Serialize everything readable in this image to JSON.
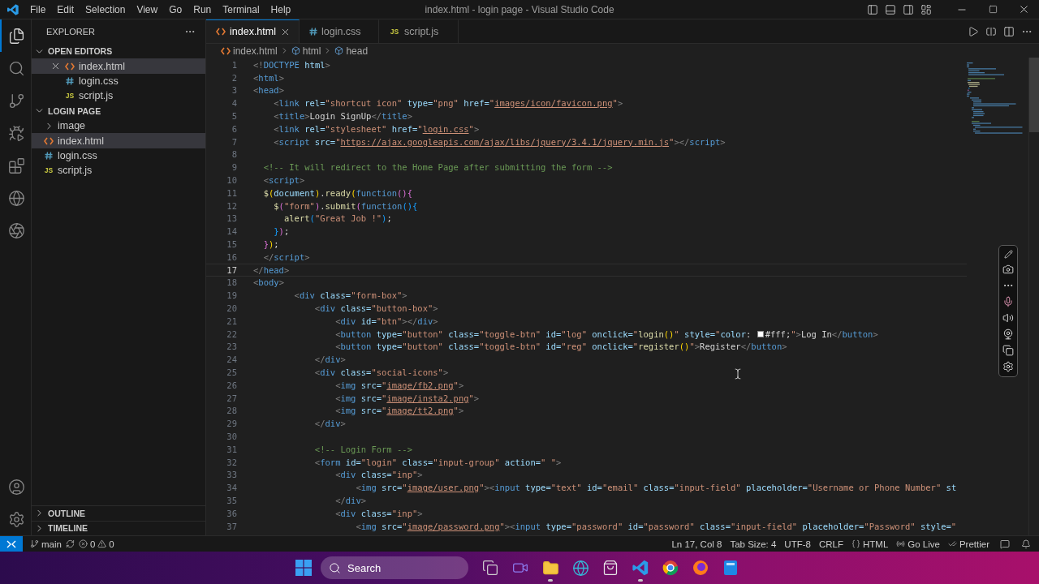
{
  "window": {
    "title": "index.html - login page - Visual Studio Code",
    "menu": [
      "File",
      "Edit",
      "Selection",
      "View",
      "Go",
      "Run",
      "Terminal",
      "Help"
    ]
  },
  "activity_bar": {
    "top": [
      {
        "kind": "files",
        "selected": true
      },
      {
        "kind": "search",
        "selected": false
      },
      {
        "kind": "source-control",
        "selected": false
      },
      {
        "kind": "run-debug",
        "selected": false
      },
      {
        "kind": "extensions",
        "selected": false
      },
      {
        "kind": "globe",
        "selected": false
      },
      {
        "kind": "aperture",
        "selected": false
      }
    ],
    "bottom": [
      {
        "kind": "account"
      },
      {
        "kind": "settings"
      }
    ]
  },
  "explorer": {
    "title": "EXPLORER",
    "sections": [
      {
        "title": "OPEN EDITORS",
        "expanded": true,
        "items": [
          {
            "name": "index.html",
            "kind": "html",
            "selected": true,
            "closable": true
          },
          {
            "name": "login.css",
            "kind": "css",
            "selected": false,
            "closable": false
          },
          {
            "name": "script.js",
            "kind": "js",
            "badge": "JS",
            "selected": false,
            "closable": false
          }
        ]
      },
      {
        "title": "LOGIN PAGE",
        "expanded": true,
        "items": [
          {
            "name": "image",
            "kind": "folder",
            "expanded": false,
            "selected": false
          },
          {
            "name": "index.html",
            "kind": "html",
            "selected": true
          },
          {
            "name": "login.css",
            "kind": "css",
            "selected": false
          },
          {
            "name": "script.js",
            "kind": "js",
            "badge": "JS",
            "selected": false
          }
        ]
      }
    ],
    "bottom_sections": [
      {
        "title": "OUTLINE",
        "expanded": false
      },
      {
        "title": "TIMELINE",
        "expanded": false
      }
    ]
  },
  "tabs": [
    {
      "name": "index.html",
      "kind": "html",
      "selected": true,
      "closable": true
    },
    {
      "name": "login.css",
      "kind": "css",
      "selected": false,
      "closable": false
    },
    {
      "name": "script.js",
      "kind": "js",
      "badge": "JS",
      "selected": false,
      "closable": false
    }
  ],
  "breadcrumb": [
    {
      "label": "index.html",
      "kind": "html"
    },
    {
      "label": "html",
      "kind": "symbol"
    },
    {
      "label": "head",
      "kind": "symbol"
    }
  ],
  "editor": {
    "lines": [
      {
        "number": "1",
        "current": false,
        "tokens": [
          {
            "kind": "p",
            "text": "<!"
          },
          {
            "kind": "tag",
            "text": "DOCTYPE"
          },
          {
            "kind": "attr",
            "text": " html"
          },
          {
            "kind": "p",
            "text": ">"
          }
        ]
      },
      {
        "number": "2",
        "current": false,
        "tokens": [
          {
            "kind": "p",
            "text": "<"
          },
          {
            "kind": "tag",
            "text": "html"
          },
          {
            "kind": "p",
            "text": ">"
          }
        ]
      },
      {
        "number": "3",
        "current": false,
        "tokens": [
          {
            "kind": "p",
            "text": "<"
          },
          {
            "kind": "tag",
            "text": "head"
          },
          {
            "kind": "p",
            "text": ">"
          }
        ]
      },
      {
        "number": "4",
        "current": false,
        "tokens": [
          {
            "kind": "p",
            "text": "    <"
          },
          {
            "kind": "tag",
            "text": "link"
          },
          {
            "kind": "attr",
            "text": " rel="
          },
          {
            "kind": "str",
            "text": "\"shortcut icon\""
          },
          {
            "kind": "attr",
            "text": " type="
          },
          {
            "kind": "str",
            "text": "\"png\""
          },
          {
            "kind": "attr",
            "text": " href="
          },
          {
            "kind": "str",
            "text": "\""
          },
          {
            "kind": "link",
            "text": "images/icon/favicon.png"
          },
          {
            "kind": "str",
            "text": "\""
          },
          {
            "kind": "p",
            "text": ">"
          }
        ]
      },
      {
        "number": "5",
        "current": false,
        "tokens": [
          {
            "kind": "p",
            "text": "    <"
          },
          {
            "kind": "tag",
            "text": "title"
          },
          {
            "kind": "p",
            "text": ">"
          },
          {
            "kind": "text",
            "text": "Login SignUp"
          },
          {
            "kind": "p",
            "text": "</"
          },
          {
            "kind": "tag",
            "text": "title"
          },
          {
            "kind": "p",
            "text": ">"
          }
        ]
      },
      {
        "number": "6",
        "current": false,
        "tokens": [
          {
            "kind": "p",
            "text": "    <"
          },
          {
            "kind": "tag",
            "text": "link"
          },
          {
            "kind": "attr",
            "text": " rel="
          },
          {
            "kind": "str",
            "text": "\"stylesheet\""
          },
          {
            "kind": "attr",
            "text": " href="
          },
          {
            "kind": "str",
            "text": "\""
          },
          {
            "kind": "link",
            "text": "login.css"
          },
          {
            "kind": "str",
            "text": "\""
          },
          {
            "kind": "p",
            "text": ">"
          }
        ]
      },
      {
        "number": "7",
        "current": false,
        "tokens": [
          {
            "kind": "p",
            "text": "    <"
          },
          {
            "kind": "tag",
            "text": "script"
          },
          {
            "kind": "attr",
            "text": " src="
          },
          {
            "kind": "str",
            "text": "\""
          },
          {
            "kind": "link",
            "text": "https://ajax.googleapis.com/ajax/libs/jquery/3.4.1/jquery.min.js"
          },
          {
            "kind": "str",
            "text": "\""
          },
          {
            "kind": "p",
            "text": "></"
          },
          {
            "kind": "tag",
            "text": "script"
          },
          {
            "kind": "p",
            "text": ">"
          }
        ]
      },
      {
        "number": "8",
        "current": false
      },
      {
        "number": "9",
        "current": false,
        "tokens": [
          {
            "kind": "cmt",
            "text": "  <!-- It will redirect to the Home Page after submitting the form -->"
          }
        ]
      },
      {
        "number": "10",
        "current": false,
        "tokens": [
          {
            "kind": "p",
            "text": "  <"
          },
          {
            "kind": "tag",
            "text": "script"
          },
          {
            "kind": "p",
            "text": ">"
          }
        ]
      },
      {
        "number": "11",
        "current": false,
        "tokens": [
          {
            "kind": "fn",
            "text": "  $"
          },
          {
            "kind": "b1",
            "text": "("
          },
          {
            "kind": "attr",
            "text": "document"
          },
          {
            "kind": "b1",
            "text": ")"
          },
          {
            "kind": "text",
            "text": "."
          },
          {
            "kind": "fn",
            "text": "ready"
          },
          {
            "kind": "b1",
            "text": "("
          },
          {
            "kind": "kw",
            "text": "function"
          },
          {
            "kind": "b2",
            "text": "(){"
          }
        ]
      },
      {
        "number": "12",
        "current": false,
        "tokens": [
          {
            "kind": "fn",
            "text": "    $"
          },
          {
            "kind": "b2",
            "text": "("
          },
          {
            "kind": "str",
            "text": "\"form\""
          },
          {
            "kind": "b2",
            "text": ")"
          },
          {
            "kind": "text",
            "text": "."
          },
          {
            "kind": "fn",
            "text": "submit"
          },
          {
            "kind": "b2",
            "text": "("
          },
          {
            "kind": "kw",
            "text": "function"
          },
          {
            "kind": "b3",
            "text": "(){"
          }
        ]
      },
      {
        "number": "13",
        "current": false,
        "tokens": [
          {
            "kind": "fn",
            "text": "      alert"
          },
          {
            "kind": "b3",
            "text": "("
          },
          {
            "kind": "str",
            "text": "\"Great Job !\""
          },
          {
            "kind": "b3",
            "text": ")"
          },
          {
            "kind": "text",
            "text": ";"
          }
        ]
      },
      {
        "number": "14",
        "current": false,
        "tokens": [
          {
            "kind": "b3",
            "text": "    }"
          },
          {
            "kind": "b2",
            "text": ")"
          },
          {
            "kind": "text",
            "text": ";"
          }
        ]
      },
      {
        "number": "15",
        "current": false,
        "tokens": [
          {
            "kind": "b2",
            "text": "  }"
          },
          {
            "kind": "b1",
            "text": ")"
          },
          {
            "kind": "text",
            "text": ";"
          }
        ]
      },
      {
        "number": "16",
        "current": false,
        "tokens": [
          {
            "kind": "p",
            "text": "  </"
          },
          {
            "kind": "tag",
            "text": "script"
          },
          {
            "kind": "p",
            "text": ">"
          }
        ]
      },
      {
        "number": "17",
        "current": true,
        "tokens": [
          {
            "kind": "p",
            "text": "</"
          },
          {
            "kind": "tag",
            "text": "head"
          },
          {
            "kind": "p",
            "text": ">"
          }
        ]
      },
      {
        "number": "18",
        "current": false,
        "tokens": [
          {
            "kind": "p",
            "text": "<"
          },
          {
            "kind": "tag",
            "text": "body"
          },
          {
            "kind": "p",
            "text": ">"
          }
        ]
      },
      {
        "number": "19",
        "current": false,
        "tokens": [
          {
            "kind": "p",
            "text": "        <"
          },
          {
            "kind": "tag",
            "text": "div"
          },
          {
            "kind": "attr",
            "text": " class="
          },
          {
            "kind": "str",
            "text": "\"form-box\""
          },
          {
            "kind": "p",
            "text": ">"
          }
        ]
      },
      {
        "number": "20",
        "current": false,
        "tokens": [
          {
            "kind": "p",
            "text": "            <"
          },
          {
            "kind": "tag",
            "text": "div"
          },
          {
            "kind": "attr",
            "text": " class="
          },
          {
            "kind": "str",
            "text": "\"button-box\""
          },
          {
            "kind": "p",
            "text": ">"
          }
        ]
      },
      {
        "number": "21",
        "current": false,
        "tokens": [
          {
            "kind": "p",
            "text": "                <"
          },
          {
            "kind": "tag",
            "text": "div"
          },
          {
            "kind": "attr",
            "text": " id="
          },
          {
            "kind": "str",
            "text": "\"btn\""
          },
          {
            "kind": "p",
            "text": "></"
          },
          {
            "kind": "tag",
            "text": "div"
          },
          {
            "kind": "p",
            "text": ">"
          }
        ]
      },
      {
        "number": "22",
        "current": false,
        "tokens": [
          {
            "kind": "p",
            "text": "                <"
          },
          {
            "kind": "tag",
            "text": "button"
          },
          {
            "kind": "attr",
            "text": " type="
          },
          {
            "kind": "str",
            "text": "\"button\""
          },
          {
            "kind": "attr",
            "text": " class="
          },
          {
            "kind": "str",
            "text": "\"toggle-btn\""
          },
          {
            "kind": "attr",
            "text": " id="
          },
          {
            "kind": "str",
            "text": "\"log\""
          },
          {
            "kind": "attr",
            "text": " onclick="
          },
          {
            "kind": "str",
            "text": "\""
          },
          {
            "kind": "fn",
            "text": "login"
          },
          {
            "kind": "b1",
            "text": "()"
          },
          {
            "kind": "str",
            "text": "\""
          },
          {
            "kind": "attr",
            "text": " style="
          },
          {
            "kind": "str",
            "text": "\""
          },
          {
            "kind": "attr",
            "text": "color"
          },
          {
            "kind": "text",
            "text": ": "
          },
          {
            "kind": "swatch",
            "color": "#ffffff"
          },
          {
            "kind": "text",
            "text": "#fff;"
          },
          {
            "kind": "str",
            "text": "\""
          },
          {
            "kind": "p",
            "text": ">"
          },
          {
            "kind": "text",
            "text": "Log In"
          },
          {
            "kind": "p",
            "text": "</"
          },
          {
            "kind": "tag",
            "text": "button"
          },
          {
            "kind": "p",
            "text": ">"
          }
        ]
      },
      {
        "number": "23",
        "current": false,
        "tokens": [
          {
            "kind": "p",
            "text": "                <"
          },
          {
            "kind": "tag",
            "text": "button"
          },
          {
            "kind": "attr",
            "text": " type="
          },
          {
            "kind": "str",
            "text": "\"button\""
          },
          {
            "kind": "attr",
            "text": " class="
          },
          {
            "kind": "str",
            "text": "\"toggle-btn\""
          },
          {
            "kind": "attr",
            "text": " id="
          },
          {
            "kind": "str",
            "text": "\"reg\""
          },
          {
            "kind": "attr",
            "text": " onclick="
          },
          {
            "kind": "str",
            "text": "\""
          },
          {
            "kind": "fn",
            "text": "register"
          },
          {
            "kind": "b1",
            "text": "()"
          },
          {
            "kind": "str",
            "text": "\""
          },
          {
            "kind": "p",
            "text": ">"
          },
          {
            "kind": "text",
            "text": "Register"
          },
          {
            "kind": "p",
            "text": "</"
          },
          {
            "kind": "tag",
            "text": "button"
          },
          {
            "kind": "p",
            "text": ">"
          }
        ]
      },
      {
        "number": "24",
        "current": false,
        "tokens": [
          {
            "kind": "p",
            "text": "            </"
          },
          {
            "kind": "tag",
            "text": "div"
          },
          {
            "kind": "p",
            "text": ">"
          }
        ]
      },
      {
        "number": "25",
        "current": false,
        "tokens": [
          {
            "kind": "p",
            "text": "            <"
          },
          {
            "kind": "tag",
            "text": "div"
          },
          {
            "kind": "attr",
            "text": " class="
          },
          {
            "kind": "str",
            "text": "\"social-icons\""
          },
          {
            "kind": "p",
            "text": ">"
          }
        ]
      },
      {
        "number": "26",
        "current": false,
        "tokens": [
          {
            "kind": "p",
            "text": "                <"
          },
          {
            "kind": "tag",
            "text": "img"
          },
          {
            "kind": "attr",
            "text": " src="
          },
          {
            "kind": "str",
            "text": "\""
          },
          {
            "kind": "link",
            "text": "image/fb2.png"
          },
          {
            "kind": "str",
            "text": "\""
          },
          {
            "kind": "p",
            "text": ">"
          }
        ]
      },
      {
        "number": "27",
        "current": false,
        "tokens": [
          {
            "kind": "p",
            "text": "                <"
          },
          {
            "kind": "tag",
            "text": "img"
          },
          {
            "kind": "attr",
            "text": " src="
          },
          {
            "kind": "str",
            "text": "\""
          },
          {
            "kind": "link",
            "text": "image/insta2.png"
          },
          {
            "kind": "str",
            "text": "\""
          },
          {
            "kind": "p",
            "text": ">"
          }
        ]
      },
      {
        "number": "28",
        "current": false,
        "tokens": [
          {
            "kind": "p",
            "text": "                <"
          },
          {
            "kind": "tag",
            "text": "img"
          },
          {
            "kind": "attr",
            "text": " src="
          },
          {
            "kind": "str",
            "text": "\""
          },
          {
            "kind": "link",
            "text": "image/tt2.png"
          },
          {
            "kind": "str",
            "text": "\""
          },
          {
            "kind": "p",
            "text": ">"
          }
        ]
      },
      {
        "number": "29",
        "current": false,
        "tokens": [
          {
            "kind": "p",
            "text": "            </"
          },
          {
            "kind": "tag",
            "text": "div"
          },
          {
            "kind": "p",
            "text": ">"
          }
        ]
      },
      {
        "number": "30",
        "current": false
      },
      {
        "number": "31",
        "current": false,
        "tokens": [
          {
            "kind": "cmt",
            "text": "            <!-- Login Form -->"
          }
        ]
      },
      {
        "number": "32",
        "current": false,
        "tokens": [
          {
            "kind": "p",
            "text": "            <"
          },
          {
            "kind": "tag",
            "text": "form"
          },
          {
            "kind": "attr",
            "text": " id="
          },
          {
            "kind": "str",
            "text": "\"login\""
          },
          {
            "kind": "attr",
            "text": " class="
          },
          {
            "kind": "str",
            "text": "\"input-group\""
          },
          {
            "kind": "attr",
            "text": " action="
          },
          {
            "kind": "str",
            "text": "\" \""
          },
          {
            "kind": "p",
            "text": ">"
          }
        ]
      },
      {
        "number": "33",
        "current": false,
        "tokens": [
          {
            "kind": "p",
            "text": "                <"
          },
          {
            "kind": "tag",
            "text": "div"
          },
          {
            "kind": "attr",
            "text": " class="
          },
          {
            "kind": "str",
            "text": "\"inp\""
          },
          {
            "kind": "p",
            "text": ">"
          }
        ]
      },
      {
        "number": "34",
        "current": false,
        "tokens": [
          {
            "kind": "p",
            "text": "                    <"
          },
          {
            "kind": "tag",
            "text": "img"
          },
          {
            "kind": "attr",
            "text": " src="
          },
          {
            "kind": "str",
            "text": "\""
          },
          {
            "kind": "link",
            "text": "image/user.png"
          },
          {
            "kind": "str",
            "text": "\""
          },
          {
            "kind": "p",
            "text": "><"
          },
          {
            "kind": "tag",
            "text": "input"
          },
          {
            "kind": "attr",
            "text": " type="
          },
          {
            "kind": "str",
            "text": "\"text\""
          },
          {
            "kind": "attr",
            "text": " id="
          },
          {
            "kind": "str",
            "text": "\"email\""
          },
          {
            "kind": "attr",
            "text": " class="
          },
          {
            "kind": "str",
            "text": "\"input-field\""
          },
          {
            "kind": "attr",
            "text": " placeholder="
          },
          {
            "kind": "str",
            "text": "\"Username or Phone Number\""
          },
          {
            "kind": "attr",
            "text": " st"
          }
        ]
      },
      {
        "number": "35",
        "current": false,
        "tokens": [
          {
            "kind": "p",
            "text": "                </"
          },
          {
            "kind": "tag",
            "text": "div"
          },
          {
            "kind": "p",
            "text": ">"
          }
        ]
      },
      {
        "number": "36",
        "current": false,
        "tokens": [
          {
            "kind": "p",
            "text": "                <"
          },
          {
            "kind": "tag",
            "text": "div"
          },
          {
            "kind": "attr",
            "text": " class="
          },
          {
            "kind": "str",
            "text": "\"inp\""
          },
          {
            "kind": "p",
            "text": ">"
          }
        ]
      },
      {
        "number": "37",
        "current": false,
        "tokens": [
          {
            "kind": "p",
            "text": "                    <"
          },
          {
            "kind": "tag",
            "text": "img"
          },
          {
            "kind": "attr",
            "text": " src="
          },
          {
            "kind": "str",
            "text": "\""
          },
          {
            "kind": "link",
            "text": "image/password.png"
          },
          {
            "kind": "str",
            "text": "\""
          },
          {
            "kind": "p",
            "text": "><"
          },
          {
            "kind": "tag",
            "text": "input"
          },
          {
            "kind": "attr",
            "text": " type="
          },
          {
            "kind": "str",
            "text": "\"password\""
          },
          {
            "kind": "attr",
            "text": " id="
          },
          {
            "kind": "str",
            "text": "\"password\""
          },
          {
            "kind": "attr",
            "text": " class="
          },
          {
            "kind": "str",
            "text": "\"input-field\""
          },
          {
            "kind": "attr",
            "text": " placeholder="
          },
          {
            "kind": "str",
            "text": "\"Password\""
          },
          {
            "kind": "attr",
            "text": " style="
          },
          {
            "kind": "str",
            "text": "\""
          }
        ]
      }
    ]
  },
  "status_bar": {
    "branch": "main",
    "problems": [
      {
        "kind": "error",
        "count": "0"
      },
      {
        "kind": "warning",
        "count": "0"
      }
    ],
    "items": [
      {
        "kind": "plain",
        "text": "Ln 17, Col 8"
      },
      {
        "kind": "plain",
        "text": "Tab Size: 4"
      },
      {
        "kind": "plain",
        "text": "UTF-8"
      },
      {
        "kind": "plain",
        "text": "CRLF"
      },
      {
        "kind": "braces",
        "text": "HTML"
      },
      {
        "kind": "broadcast",
        "text": "Go Live"
      },
      {
        "kind": "checks",
        "text": "Prettier"
      }
    ]
  },
  "taskbar": {
    "search_label": "Search",
    "apps": [
      {
        "kind": "task-view",
        "running": false
      },
      {
        "kind": "video",
        "running": false
      },
      {
        "kind": "folder",
        "running": true
      },
      {
        "kind": "globe",
        "running": false
      },
      {
        "kind": "store",
        "running": false
      },
      {
        "kind": "editor",
        "running": true
      },
      {
        "kind": "ring",
        "running": false
      },
      {
        "kind": "ball",
        "running": false
      },
      {
        "kind": "tile",
        "running": false
      }
    ]
  }
}
